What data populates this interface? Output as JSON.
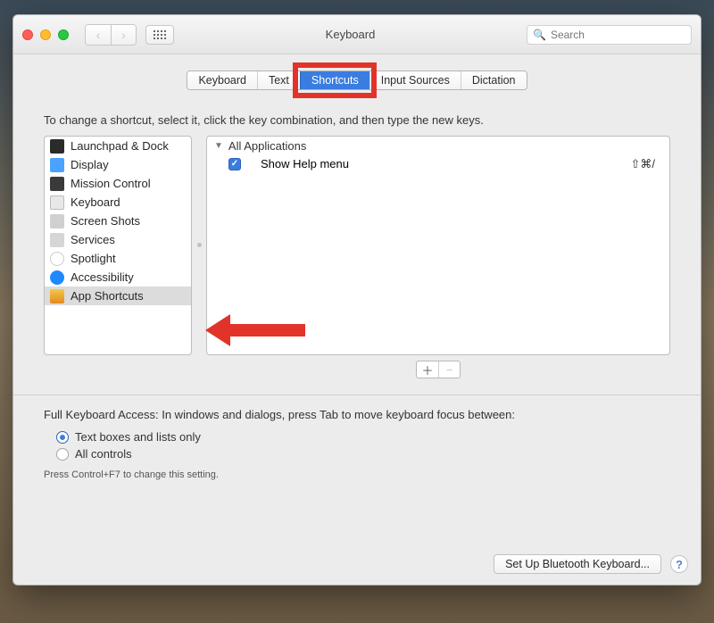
{
  "window_title": "Keyboard",
  "search_placeholder": "Search",
  "tabs": [
    "Keyboard",
    "Text",
    "Shortcuts",
    "Input Sources",
    "Dictation"
  ],
  "selected_tab": 2,
  "instruction": "To change a shortcut, select it, click the key combination, and then type the new keys.",
  "categories": [
    {
      "label": "Launchpad & Dock",
      "icon": "ic-lp"
    },
    {
      "label": "Display",
      "icon": "ic-dp"
    },
    {
      "label": "Mission Control",
      "icon": "ic-mc"
    },
    {
      "label": "Keyboard",
      "icon": "ic-kb"
    },
    {
      "label": "Screen Shots",
      "icon": "ic-ss"
    },
    {
      "label": "Services",
      "icon": "ic-sv"
    },
    {
      "label": "Spotlight",
      "icon": "ic-sp"
    },
    {
      "label": "Accessibility",
      "icon": "ic-ac"
    },
    {
      "label": "App Shortcuts",
      "icon": "ic-as"
    }
  ],
  "selected_category": 8,
  "shortcut_group": "All Applications",
  "shortcuts": [
    {
      "label": "Show Help menu",
      "keys": "⇧⌘/",
      "checked": true
    }
  ],
  "access_title": "Full Keyboard Access: In windows and dialogs, press Tab to move keyboard focus between:",
  "access_options": [
    "Text boxes and lists only",
    "All controls"
  ],
  "access_selected": 0,
  "access_hint": "Press Control+F7 to change this setting.",
  "bluetooth_btn": "Set Up Bluetooth Keyboard...",
  "colors": {
    "accent": "#3a7de0",
    "annotation": "#e2332a"
  }
}
